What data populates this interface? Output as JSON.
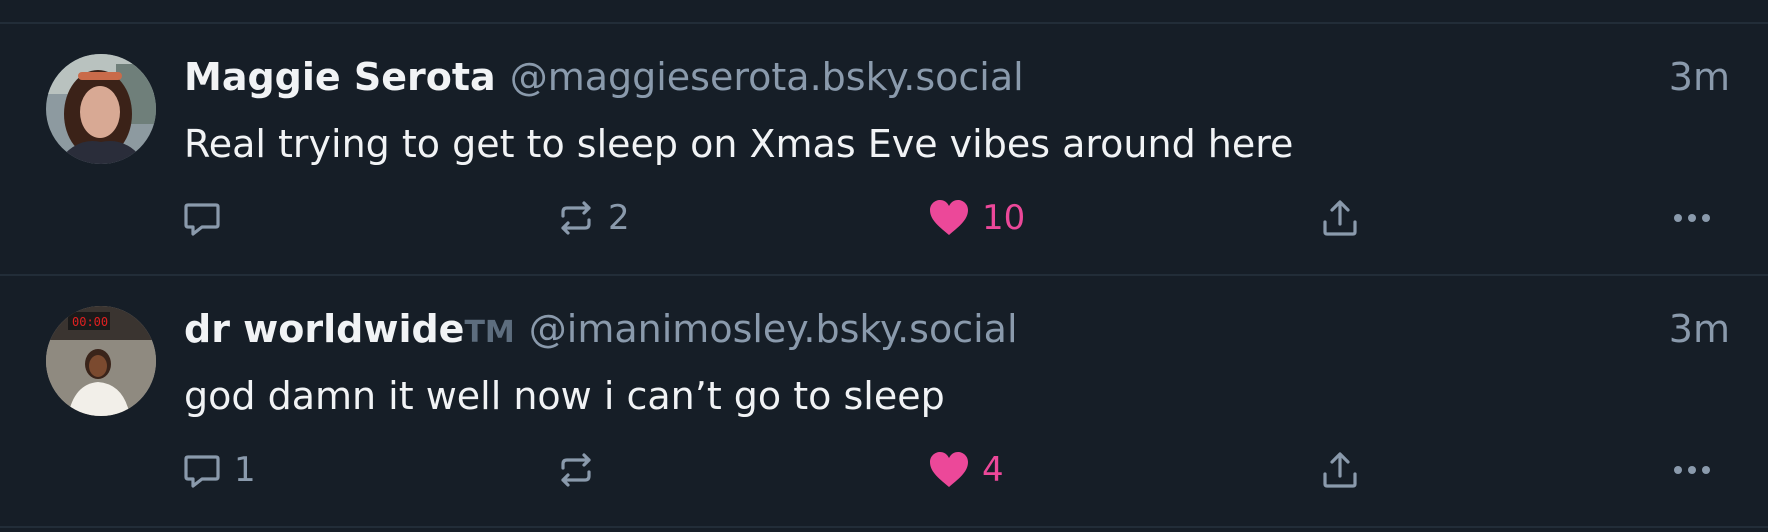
{
  "posts": [
    {
      "author": {
        "display_name": "Maggie Serota",
        "suffix": "",
        "handle": "@maggieserota.bsky.social"
      },
      "time": "3m",
      "text": "Real trying to get to sleep on Xmas Eve vibes around here",
      "reply_count": "",
      "repost_count": "2",
      "like_count": "10",
      "liked": true
    },
    {
      "author": {
        "display_name": "dr worldwide",
        "suffix": "TM",
        "handle": "@imanimosley.bsky.social"
      },
      "time": "3m",
      "text": "god damn it well now i can’t go to sleep",
      "reply_count": "1",
      "repost_count": "",
      "like_count": "4",
      "liked": true
    }
  ],
  "colors": {
    "background": "#161e27",
    "divider": "#222d38",
    "text_primary": "#f1f3f5",
    "text_muted": "#8a9aac",
    "like_accent": "#ec4899"
  },
  "icons": {
    "reply": "speech-bubble-icon",
    "repost": "repost-arrows-icon",
    "like": "heart-icon",
    "share": "share-upload-icon",
    "more": "ellipsis-icon"
  }
}
